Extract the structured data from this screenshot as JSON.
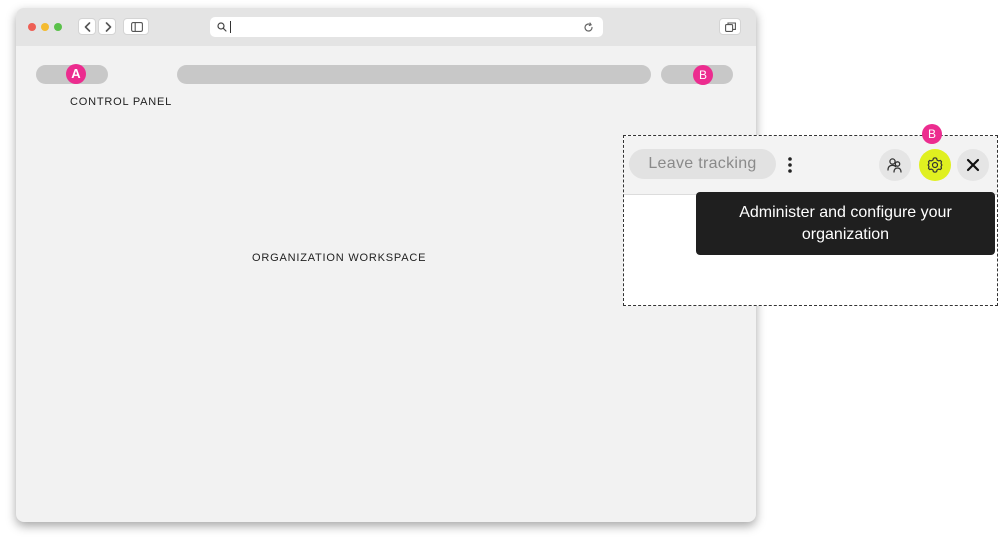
{
  "browser": {
    "url_value": "",
    "controls": {
      "back_icon": "chevron-left-icon",
      "forward_icon": "chevron-right-icon",
      "sidebar_icon": "sidebar-icon",
      "search_icon": "search-icon",
      "reload_icon": "reload-icon",
      "tabs_icon": "tabs-overview-icon"
    }
  },
  "markers": {
    "a": "A",
    "b": "B"
  },
  "labels": {
    "control_panel": "CONTROL PANEL",
    "organization_workspace": "ORGANIZATION WORKSPACE"
  },
  "callout": {
    "marker": "B",
    "leave_button": "Leave tracking",
    "tooltip": "Administer and configure your organization",
    "icons": {
      "more": "more-vertical-icon",
      "people": "people-icon",
      "settings": "settings-gear-icon",
      "close": "close-icon"
    }
  },
  "colors": {
    "marker": "#ec2c8f",
    "settings_highlight": "#e0f020",
    "tooltip_bg": "#1f1f1f",
    "window_bg": "#f2f2f2",
    "pill_placeholder": "#c8c8c8"
  }
}
